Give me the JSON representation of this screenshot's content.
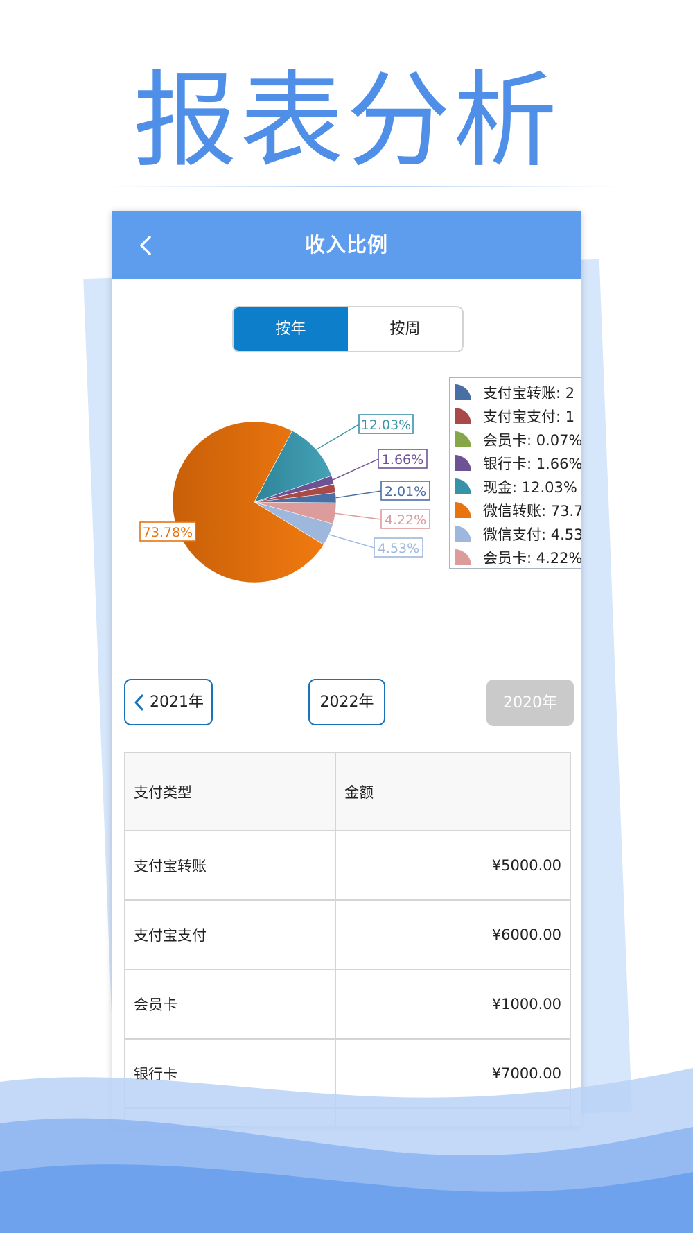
{
  "hero": {
    "title": "报表分析"
  },
  "navbar": {
    "title": "收入比例"
  },
  "segment": {
    "options": [
      "按年",
      "按周"
    ],
    "active_index": 0
  },
  "years": {
    "prev": "2021年",
    "current": "2022年",
    "next": "2020年"
  },
  "table": {
    "headers": [
      "支付类型",
      "金额"
    ],
    "rows": [
      {
        "type": "支付宝转账",
        "amount": "¥5000.00"
      },
      {
        "type": "支付宝支付",
        "amount": "¥6000.00"
      },
      {
        "type": "会员卡",
        "amount": "¥1000.00"
      },
      {
        "type": "银行卡",
        "amount": "¥7000.00"
      }
    ]
  },
  "chart_data": {
    "type": "pie",
    "slices": [
      {
        "legend": "支付宝转账: 2",
        "value": 2.01,
        "label": "2.01%",
        "color": "#4a6fa5"
      },
      {
        "legend": "支付宝支付: 1",
        "value": 1.7,
        "label": "",
        "color": "#a94a48"
      },
      {
        "legend": "会员卡: 0.07%",
        "value": 0.07,
        "label": "",
        "color": "#86a64a"
      },
      {
        "legend": "银行卡: 1.66%",
        "value": 1.66,
        "label": "1.66%",
        "color": "#6e5394"
      },
      {
        "legend": "现金: 12.03%",
        "value": 12.03,
        "label": "12.03%",
        "color": "#3993a8"
      },
      {
        "legend": "微信转账: 73.7",
        "value": 73.78,
        "label": "73.78%",
        "color": "#e8740f"
      },
      {
        "legend": "微信支付: 4.53",
        "value": 4.53,
        "label": "4.53%",
        "color": "#9db7dd"
      },
      {
        "legend": "会员卡: 4.22%",
        "value": 4.22,
        "label": "4.22%",
        "color": "#dc9c9b"
      }
    ],
    "legend_position": "right"
  },
  "colors": {
    "accent": "#5e9ded",
    "hero": "#4f8fe8",
    "segment_active": "#0d7ec9",
    "disabled": "#cacaca"
  }
}
